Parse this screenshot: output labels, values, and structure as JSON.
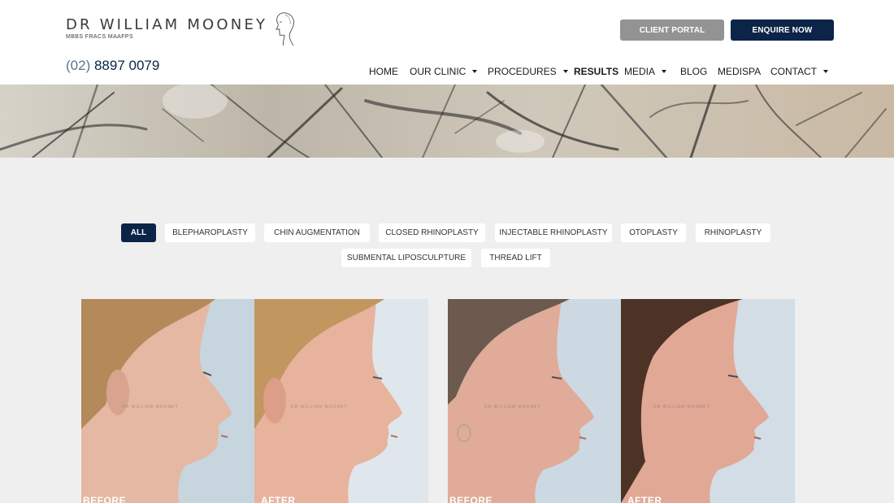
{
  "brand": {
    "name": "DR WILLIAM MOONEY",
    "credentials": "MBBS FRACS MAAFPS",
    "phone_area": "(02)",
    "phone_number": "8897 0079"
  },
  "header_buttons": {
    "client_portal": "CLIENT PORTAL",
    "enquire_now": "ENQUIRE NOW"
  },
  "nav": [
    {
      "label": "HOME",
      "dropdown": false
    },
    {
      "label": "OUR CLINIC",
      "dropdown": true
    },
    {
      "label": "PROCEDURES",
      "dropdown": true
    },
    {
      "label": "RESULTS",
      "dropdown": false,
      "active": true
    },
    {
      "label": "MEDIA",
      "dropdown": true
    },
    {
      "label": "BLOG",
      "dropdown": false
    },
    {
      "label": "MEDISPA",
      "dropdown": false
    },
    {
      "label": "CONTACT",
      "dropdown": true
    }
  ],
  "filters": [
    {
      "label": "ALL",
      "active": true
    },
    {
      "label": "BLEPHAROPLASTY"
    },
    {
      "label": "CHIN AUGMENTATION"
    },
    {
      "label": "CLOSED RHINOPLASTY"
    },
    {
      "label": "INJECTABLE RHINOPLASTY"
    },
    {
      "label": "OTOPLASTY"
    },
    {
      "label": "RHINOPLASTY"
    },
    {
      "label": "SUBMENTAL LIPOSCULPTURE"
    },
    {
      "label": "THREAD LIFT"
    }
  ],
  "gallery": [
    {
      "label": "BEFORE",
      "watermark": "DR WILLIAM MOONEY"
    },
    {
      "label": "AFTER",
      "watermark": "DR WILLIAM MOONEY"
    },
    {
      "label": "BEFORE",
      "watermark": "DR WILLIAM MOONEY"
    },
    {
      "label": "AFTER",
      "watermark": "DR WILLIAM MOONEY"
    }
  ],
  "colors": {
    "navy": "#0b2447",
    "portal_grey": "#939393",
    "page_bg": "#efefef"
  },
  "icons": {
    "logo_face": "face-profile-sketch-icon",
    "nav_dropdown": "caret-down-icon"
  }
}
